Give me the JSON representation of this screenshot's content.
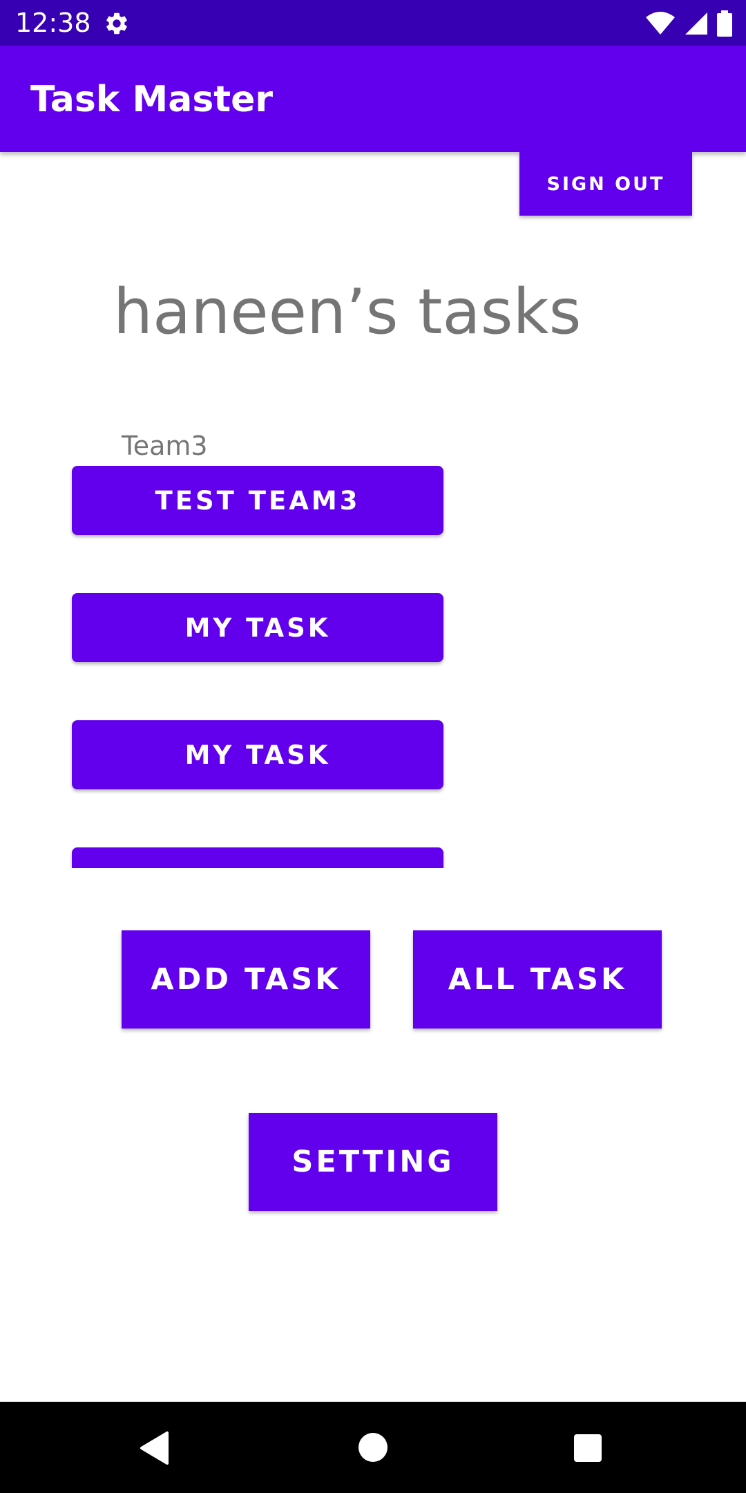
{
  "status_bar": {
    "time": "12:38",
    "icons": [
      "gear-icon",
      "wifi-icon",
      "signal-icon",
      "battery-icon"
    ]
  },
  "app_bar": {
    "title": "Task Master"
  },
  "actions": {
    "sign_out": "SIGN OUT"
  },
  "main": {
    "heading": "haneen’s tasks",
    "team_label": "Team3",
    "tasks": [
      "TEST TEAM3",
      "MY TASK",
      "MY TASK",
      ""
    ],
    "add_task": "ADD TASK",
    "all_task": "ALL TASK",
    "setting": "SETTING"
  },
  "nav_bar": {
    "icons": [
      "back-icon",
      "home-icon",
      "recents-icon"
    ]
  },
  "colors": {
    "status_bar": "#3700b3",
    "primary": "#6200ee",
    "text_secondary": "#757575",
    "nav_bar": "#000000"
  }
}
